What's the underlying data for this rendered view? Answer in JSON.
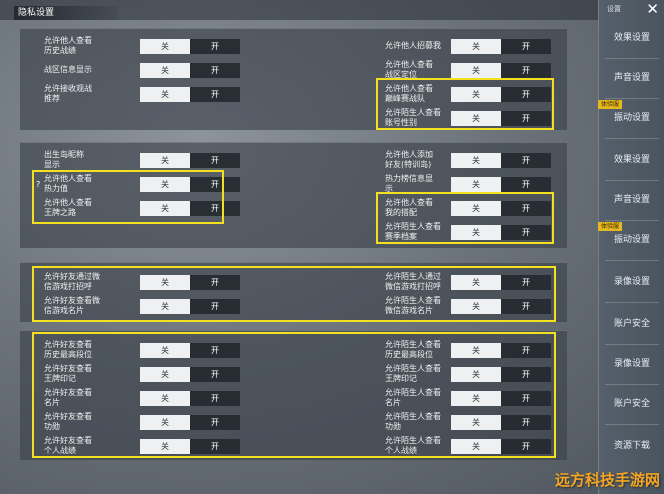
{
  "window": {
    "title": "隐私设置"
  },
  "toggle": {
    "off": "关",
    "on": "开"
  },
  "sidebar": {
    "header": "设置",
    "close": "✕",
    "items": [
      "效果设置",
      "声音设置",
      "振动设置",
      "效果设置",
      "声音设置",
      "振动设置",
      "录像设置",
      "账户安全",
      "录像设置",
      "账户安全",
      "资源下载"
    ],
    "tags": [
      "体验服",
      "体验服"
    ]
  },
  "panel1": {
    "left": [
      "允许他人查看\n历史战绩",
      "战区信息显示",
      "允许接收观战\n推荐"
    ],
    "right": [
      "允许他人招募我",
      "允许他人查看\n战区定位",
      "允许他人查看\n巅峰赛战队",
      "允许陌生人查看\n账号性别"
    ]
  },
  "panel2": {
    "left": [
      "出生岛昵称\n显示",
      "允许他人查看\n热力值",
      "允许他人查看\n王牌之路"
    ],
    "right": [
      "允许他人添加\n好友(特训岛)",
      "热力榜信息显\n示",
      "允许他人查看\n我的搭配",
      "允许陌生人查看\n赛季档案"
    ]
  },
  "panel3": {
    "left": [
      "允许好友通过微\n信游戏打招呼",
      "允许好友查看微\n信游戏名片"
    ],
    "right": [
      "允许陌生人通过\n微信游戏打招呼",
      "允许陌生人查看\n微信游戏名片"
    ]
  },
  "panel4": {
    "left": [
      "允许好友查看\n历史最高段位",
      "允许好友查看\n王牌印记",
      "允许好友查看\n名片",
      "允许好友查看\n功勋",
      "允许好友查看\n个人战绩"
    ],
    "right": [
      "允许陌生人查看\n历史最高段位",
      "允许陌生人查看\n王牌印记",
      "允许陌生人查看\n名片",
      "允许陌生人查看\n功勋",
      "允许陌生人查看\n个人战绩"
    ]
  },
  "qmark": "?",
  "watermark": "远方科技手游网"
}
